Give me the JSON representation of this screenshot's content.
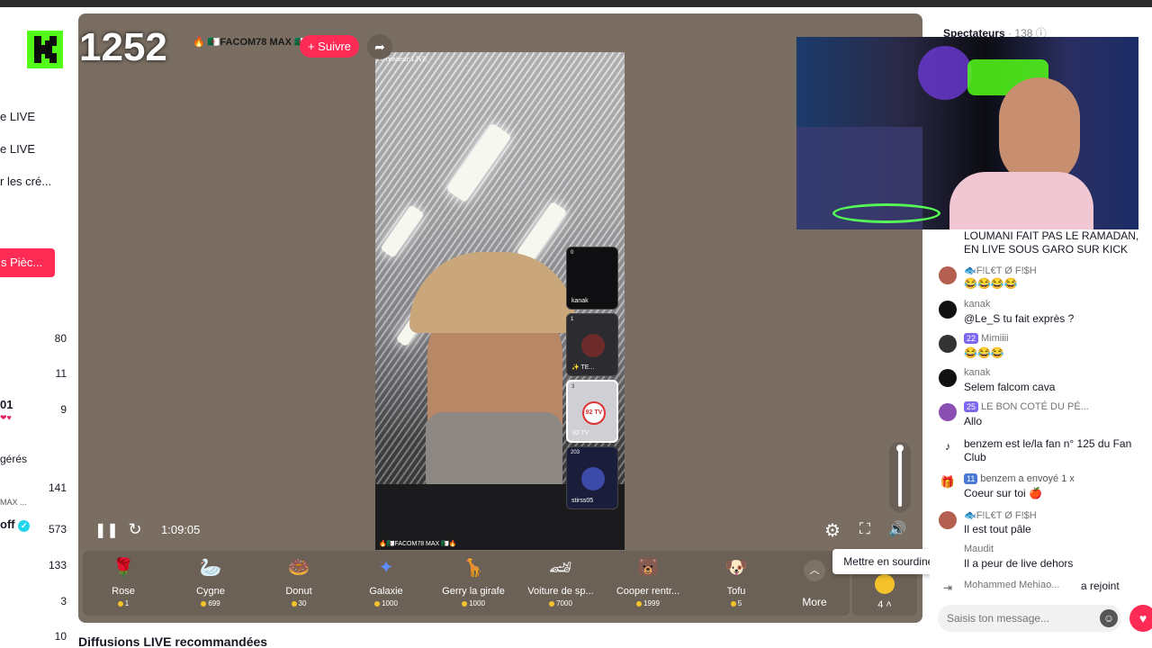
{
  "sidebar": {
    "nav": [
      {
        "label": "e LIVE"
      },
      {
        "label": "e LIVE"
      },
      {
        "label": "r les cré..."
      }
    ],
    "coins_button": "s Pièc...",
    "section_label": "gérés",
    "entries": [
      {
        "label": "",
        "value": "80"
      },
      {
        "label": "",
        "value": "11"
      },
      {
        "label": "01",
        "value": "9"
      },
      {
        "label": "MAX ...",
        "value": "141"
      },
      {
        "label": "off",
        "value": "573"
      },
      {
        "label": "",
        "value": "133"
      },
      {
        "label": "",
        "value": "3"
      },
      {
        "label": "",
        "value": "10"
      }
    ]
  },
  "overlay": {
    "kick_count": "1252",
    "host_name": "🔥 🇩🇿FACOM78 MAX 🇩🇿🔥",
    "follow_label": "+ Suivre"
  },
  "video": {
    "top_label": "Créateur LIVE",
    "bottom_label": "🔥🇩🇿FACOM78 MAX 🇩🇿🔥"
  },
  "guests": [
    {
      "badge": "0",
      "name": "kanak"
    },
    {
      "badge": "1",
      "name": "✨ TE..."
    },
    {
      "badge": "3",
      "name": "92 TV",
      "logo": "92 TV"
    },
    {
      "badge": "203",
      "name": "stirss05"
    }
  ],
  "controls": {
    "time": "1:09:05",
    "tooltip": "Mettre en sourdine (M)",
    "more_label": "More",
    "extra_count": "4"
  },
  "gifts": [
    {
      "name": "Rose",
      "price": "1",
      "icon": "🌹",
      "color": "#e8324d"
    },
    {
      "name": "Cygne",
      "price": "699",
      "icon": "🦢",
      "color": "#c9d8f0"
    },
    {
      "name": "Donut",
      "price": "30",
      "icon": "🍩",
      "color": "#f3a3c6"
    },
    {
      "name": "Galaxie",
      "price": "1000",
      "icon": "✦",
      "color": "#3b6ff0"
    },
    {
      "name": "Gerry la girafe",
      "price": "1000",
      "icon": "🦒",
      "color": "#d8a64a"
    },
    {
      "name": "Voiture de sp...",
      "price": "7000",
      "icon": "🏎",
      "color": "#e84fa0"
    },
    {
      "name": "Cooper rentr...",
      "price": "1999",
      "icon": "🐻",
      "color": "#e0b070"
    },
    {
      "name": "Tofu",
      "price": "5",
      "icon": "🐶",
      "color": "#e39a3d"
    }
  ],
  "recommended_title": "Diffusions LIVE recommandées",
  "chat": {
    "header_label": "Spectateurs",
    "viewer_count": "138",
    "messages": [
      {
        "user": "",
        "text": "LOUMANI FAIT PAS LE RAMADAN,",
        "text2": "EN LIVE SOUS GARO SUR KICK"
      },
      {
        "user": "🐟F!L€T Ø F!$H",
        "text": "😂😂😂😂"
      },
      {
        "user": "kanak",
        "text": "@Le_S tu fait exprès ?"
      },
      {
        "user": "Mimiiii",
        "level": "22",
        "text": "😂😂😂"
      },
      {
        "user": "kanak",
        "text": "Selem falcom cava"
      },
      {
        "user": "LE BON COTÉ DU PÉ...",
        "level": "25",
        "text": "Allo"
      },
      {
        "user": "",
        "text": "benzem est le/la fan n° 125 du Fan",
        "text2": "Club"
      },
      {
        "user": "benzem a envoyé 1 x",
        "level": "11",
        "text": "Coeur sur toi 🍎"
      },
      {
        "user": "🐟F!L€T Ø F!$H",
        "text": "Il est tout pâle"
      },
      {
        "user": "Maudit",
        "text": "Il a peur de live dehors"
      },
      {
        "user": "Mohammed Mehiao...",
        "text": "a rejoint"
      }
    ],
    "input_placeholder": "Saisis ton message..."
  },
  "colors": {
    "accent": "#fe2c55",
    "kick_green": "#53fc18",
    "player_bg": "#7a6e62"
  }
}
